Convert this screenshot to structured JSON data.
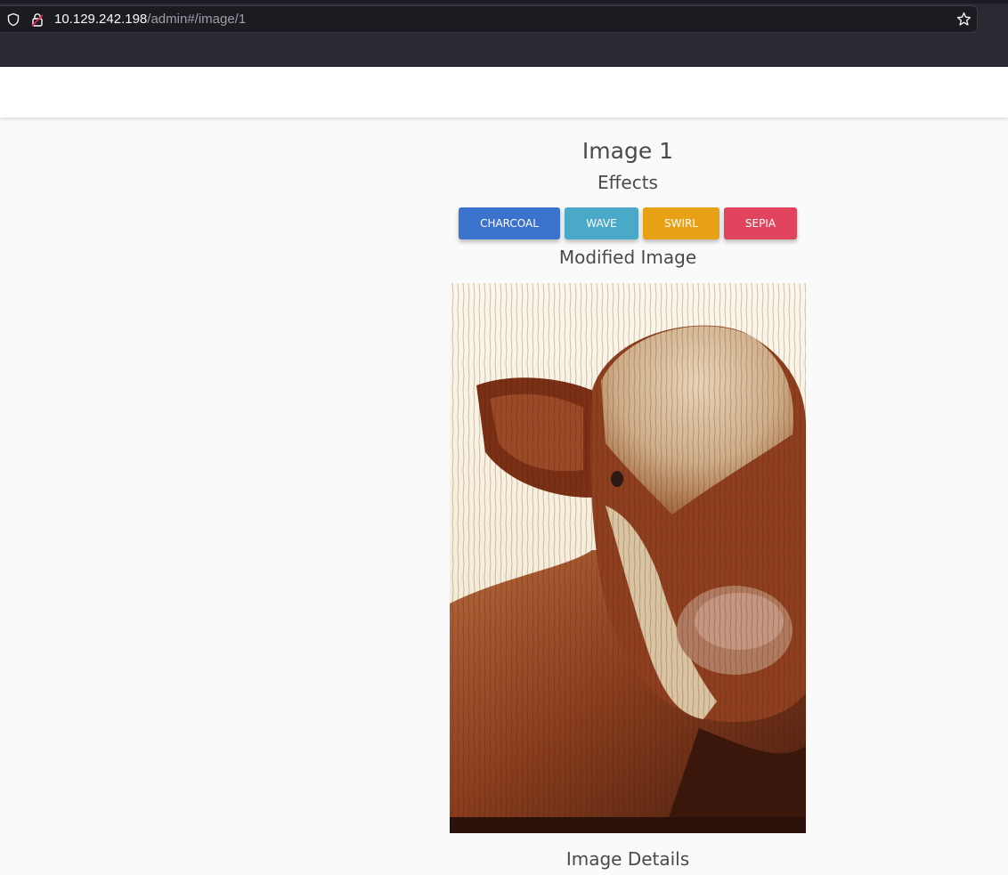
{
  "browser": {
    "url_host": "10.129.242.198",
    "url_path": "/admin#/image/1",
    "icons": {
      "shield": "shield-icon",
      "insecure_lock": "insecure-lock-icon",
      "bookmark": "star-icon"
    }
  },
  "page": {
    "title": "Image 1",
    "effects_heading": "Effects",
    "effects": [
      {
        "label": "CHARCOAL",
        "color": "#3b72ce"
      },
      {
        "label": "WAVE",
        "color": "#4aa9c9"
      },
      {
        "label": "SWIRL",
        "color": "#e8a117"
      },
      {
        "label": "SEPIA",
        "color": "#e1455e"
      }
    ],
    "modified_heading": "Modified Image",
    "image_alt": "wave-distorted photo of a brown and white cow",
    "details_heading": "Image Details"
  },
  "colors": {
    "chrome_bg": "#2b2a33",
    "page_bg": "#fafafa",
    "text": "#4a4a4a"
  }
}
